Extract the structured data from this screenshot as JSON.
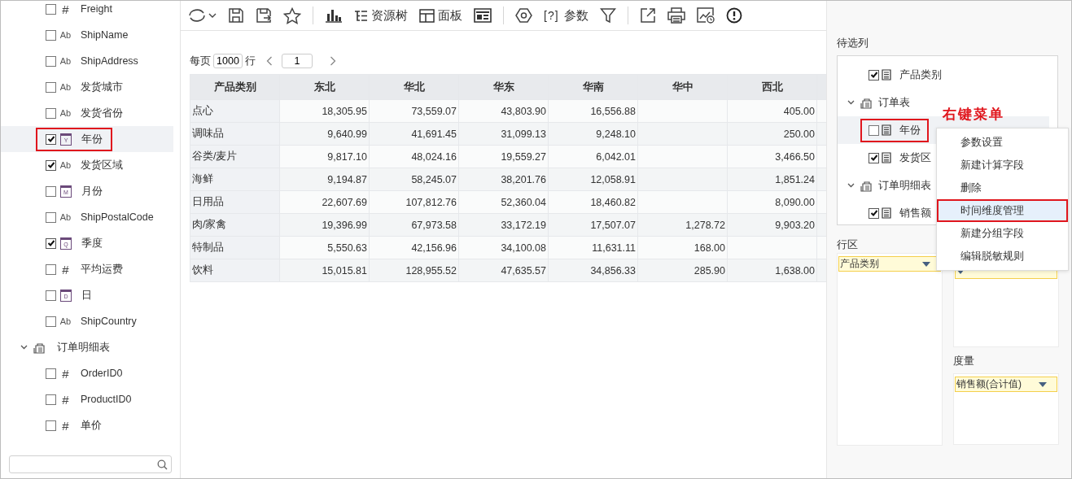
{
  "sidebar": {
    "items": [
      {
        "kind": "number",
        "icon": "#",
        "label": "Freight",
        "checked": false,
        "selected": false
      },
      {
        "kind": "text",
        "icon": "Ab",
        "label": "ShipName",
        "checked": false,
        "selected": false
      },
      {
        "kind": "text",
        "icon": "Ab",
        "label": "ShipAddress",
        "checked": false,
        "selected": false
      },
      {
        "kind": "text",
        "icon": "Ab",
        "label": "发货城市",
        "checked": false,
        "selected": false
      },
      {
        "kind": "text",
        "icon": "Ab",
        "label": "发货省份",
        "checked": false,
        "selected": false
      },
      {
        "kind": "date",
        "icon": "Y",
        "label": "年份",
        "checked": true,
        "selected": true
      },
      {
        "kind": "text",
        "icon": "Ab",
        "label": "发货区域",
        "checked": true,
        "selected": false
      },
      {
        "kind": "date",
        "icon": "M",
        "label": "月份",
        "checked": false,
        "selected": false
      },
      {
        "kind": "text",
        "icon": "Ab",
        "label": "ShipPostalCode",
        "checked": false,
        "selected": false
      },
      {
        "kind": "date",
        "icon": "Q",
        "label": "季度",
        "checked": true,
        "selected": false
      },
      {
        "kind": "number",
        "icon": "#",
        "label": "平均运费",
        "checked": false,
        "selected": false
      },
      {
        "kind": "date",
        "icon": "D",
        "label": "日",
        "checked": false,
        "selected": false
      },
      {
        "kind": "text",
        "icon": "Ab",
        "label": "ShipCountry",
        "checked": false,
        "selected": false
      },
      {
        "kind": "table",
        "label": "订单明细表",
        "expanded": true
      },
      {
        "kind": "number",
        "icon": "#",
        "label": "OrderID0",
        "checked": false,
        "selected": false
      },
      {
        "kind": "number",
        "icon": "#",
        "label": "ProductID0",
        "checked": false,
        "selected": false
      },
      {
        "kind": "number",
        "icon": "#",
        "label": "单价",
        "checked": false,
        "selected": false
      }
    ]
  },
  "toolbar": [
    {
      "kind": "refresh"
    },
    {
      "kind": "caret"
    },
    {
      "kind": "save"
    },
    {
      "kind": "save_as"
    },
    {
      "kind": "star"
    },
    {
      "kind": "separator"
    },
    {
      "kind": "chart"
    },
    {
      "kind": "tree",
      "label": "资源树"
    },
    {
      "kind": "panel",
      "label": "面板"
    },
    {
      "kind": "layout"
    },
    {
      "kind": "separator"
    },
    {
      "kind": "gear"
    },
    {
      "kind": "param",
      "icon": "[?]",
      "label": "参数"
    },
    {
      "kind": "filter"
    },
    {
      "kind": "separator"
    },
    {
      "kind": "export"
    },
    {
      "kind": "print"
    },
    {
      "kind": "schedule"
    },
    {
      "kind": "info"
    }
  ],
  "pager": {
    "per_page_label": "每页",
    "per_page": "1000",
    "rows_label": "行",
    "page": "1"
  },
  "table": {
    "columns": [
      "产品类别",
      "东北",
      "华北",
      "华东",
      "华南",
      "华中",
      "西北"
    ],
    "rows": [
      [
        "点心",
        "18,305.95",
        "73,559.07",
        "43,803.90",
        "16,556.88",
        "",
        "405.00"
      ],
      [
        "调味品",
        "9,640.99",
        "41,691.45",
        "31,099.13",
        "9,248.10",
        "",
        "250.00"
      ],
      [
        "谷类/麦片",
        "9,817.10",
        "48,024.16",
        "19,559.27",
        "6,042.01",
        "",
        "3,466.50"
      ],
      [
        "海鲜",
        "9,194.87",
        "58,245.07",
        "38,201.76",
        "12,058.91",
        "",
        "1,851.24"
      ],
      [
        "日用品",
        "22,607.69",
        "107,812.76",
        "52,360.04",
        "18,460.82",
        "",
        "8,090.00"
      ],
      [
        "肉/家禽",
        "19,396.99",
        "67,973.58",
        "33,172.19",
        "17,507.07",
        "1,278.72",
        "9,903.20"
      ],
      [
        "特制品",
        "5,550.63",
        "42,156.96",
        "34,100.08",
        "11,631.11",
        "168.00",
        ""
      ],
      [
        "饮料",
        "15,015.81",
        "128,955.52",
        "47,635.57",
        "34,856.33",
        "285.90",
        "1,638.00"
      ]
    ]
  },
  "right_panel": {
    "candidates_label": "待选列",
    "tree": [
      {
        "kind": "field",
        "label": "产品类别",
        "checked": true,
        "selected": false
      },
      {
        "kind": "table",
        "label": "订单表",
        "expanded": true
      },
      {
        "kind": "field",
        "label": "年份",
        "checked": false,
        "selected": true
      },
      {
        "kind": "field",
        "label": "发货区",
        "checked": true,
        "selected": false
      },
      {
        "kind": "table",
        "label": "订单明细表",
        "expanded": true
      },
      {
        "kind": "field",
        "label": "销售额",
        "checked": true,
        "selected": false
      }
    ],
    "annotation": "右键菜单",
    "context_menu": [
      {
        "label": "参数设置",
        "selected": false
      },
      {
        "label": "新建计算字段",
        "selected": false
      },
      {
        "label": "删除",
        "selected": false
      },
      {
        "label": "时间维度管理",
        "selected": true
      },
      {
        "label": "新建分组字段",
        "selected": false
      },
      {
        "label": "编辑脱敏规则",
        "selected": false
      }
    ],
    "row_area": {
      "label": "行区",
      "fields": [
        "产品类别"
      ]
    },
    "column_area": {
      "fields": [
        {
          "kind": "covered"
        }
      ]
    },
    "measure_area": {
      "label": "度量",
      "fields": [
        "销售额(合计值)"
      ]
    }
  }
}
